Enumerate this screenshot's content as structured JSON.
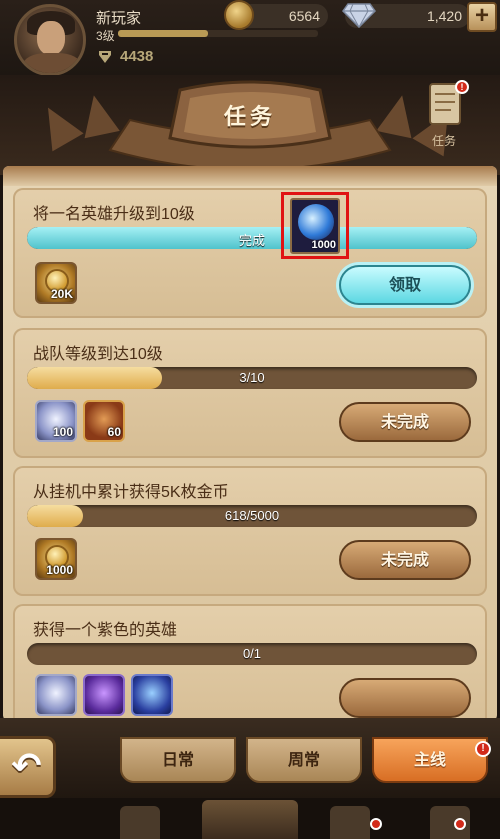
{
  "player": {
    "name": "新玩家",
    "level": "3级",
    "xp_fraction": 0.45,
    "power": "4438"
  },
  "resources": {
    "gold": "6564",
    "gems": "1,420",
    "add_label": "+"
  },
  "header": {
    "title": "任务",
    "side_icon": "scroll-icon",
    "side_label": "任务",
    "notif": "!"
  },
  "tasks": [
    {
      "title": "将一名英雄升级到10级",
      "progress_text": "完成",
      "progress_fraction": 1.0,
      "status": "complete",
      "rewards": [
        {
          "icon": "gold-coin-icon",
          "qty": "20K"
        }
      ],
      "extra_item": {
        "icon": "blue-orb-icon",
        "qty": "1000"
      },
      "button": "领取"
    },
    {
      "title": "战队等级到达10级",
      "progress_text": "3/10",
      "progress_fraction": 0.3,
      "status": "incomplete",
      "rewards": [
        {
          "icon": "silver-chest-icon",
          "qty": "100"
        },
        {
          "icon": "medal-icon",
          "qty": "60"
        }
      ],
      "button": "未完成"
    },
    {
      "title": "从挂机中累计获得5K枚金币",
      "progress_text": "618/5000",
      "progress_fraction": 0.1236,
      "status": "incomplete",
      "rewards": [
        {
          "icon": "gold-coin-icon",
          "qty": "1000"
        }
      ],
      "button": "未完成"
    },
    {
      "title": "获得一个紫色的英雄",
      "progress_text": "0/1",
      "progress_fraction": 0,
      "status": "incomplete",
      "rewards": [
        {
          "icon": "silver-chest-icon",
          "qty": ""
        },
        {
          "icon": "purple-crystal-icon",
          "qty": ""
        },
        {
          "icon": "blue-orb-icon",
          "qty": ""
        }
      ],
      "button": ""
    }
  ],
  "tabs": {
    "daily": "日常",
    "weekly": "周常",
    "main": "主线",
    "back_icon": "back-arrow-icon",
    "main_notif": "!"
  },
  "colors": {
    "claim": "#5cd8e2",
    "todo": "#9b6a3d",
    "active_tab": "#d86e24",
    "highlight": "#e01313"
  }
}
